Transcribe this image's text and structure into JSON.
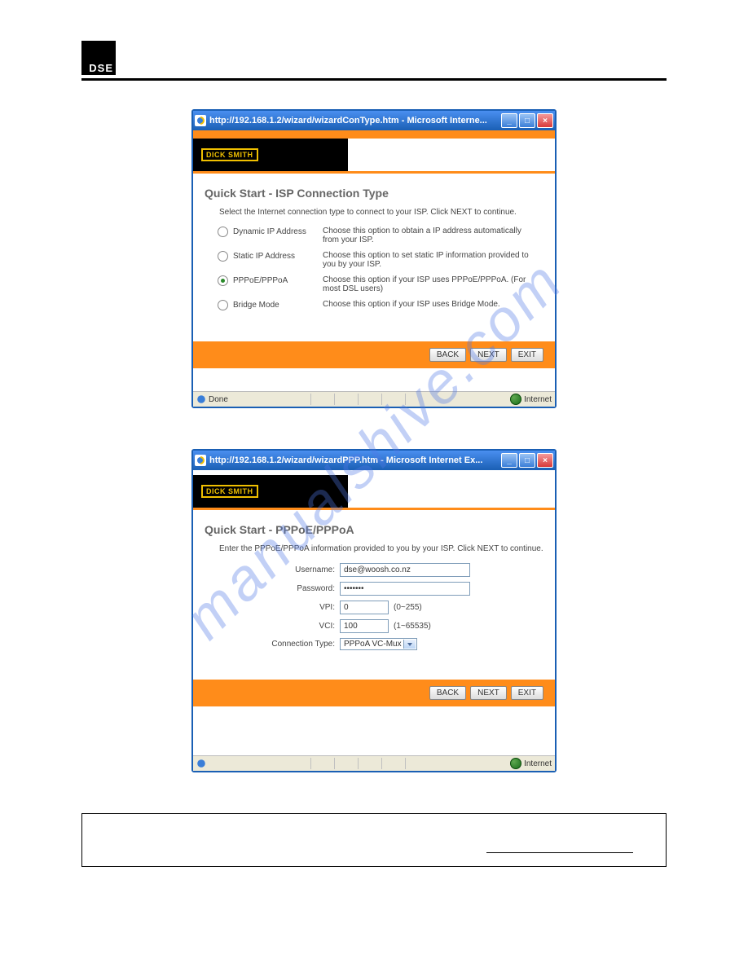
{
  "logo": "DSE",
  "watermark": "manualshive.com",
  "window1": {
    "title": "http://192.168.1.2/wizard/wizardConType.htm - Microsoft Interne...",
    "brandLabel": "DICK SMITH",
    "panelTitle": "Quick Start - ISP Connection Type",
    "panelSub": "Select the Internet connection type to connect to your ISP. Click NEXT to continue.",
    "options": [
      {
        "label": "Dynamic IP Address",
        "desc": "Choose this option to obtain a IP address automatically from your ISP.",
        "checked": false
      },
      {
        "label": "Static IP Address",
        "desc": "Choose this option to set static IP information provided to you by your ISP.",
        "checked": false
      },
      {
        "label": "PPPoE/PPPoA",
        "desc": "Choose this option if your ISP uses PPPoE/PPPoA. (For most DSL users)",
        "checked": true
      },
      {
        "label": "Bridge Mode",
        "desc": "Choose this option if your ISP uses Bridge Mode.",
        "checked": false
      }
    ],
    "buttons": {
      "back": "BACK",
      "next": "NEXT",
      "exit": "EXIT"
    },
    "status": {
      "left": "Done",
      "right": "Internet"
    }
  },
  "window2": {
    "title": "http://192.168.1.2/wizard/wizardPPP.htm - Microsoft Internet Ex...",
    "brandLabel": "DICK SMITH",
    "panelTitle": "Quick Start - PPPoE/PPPoA",
    "panelSub": "Enter the PPPoE/PPPoA information provided to you by your ISP. Click NEXT to continue.",
    "fields": {
      "usernameLabel": "Username:",
      "usernameValue": "dse@woosh.co.nz",
      "passwordLabel": "Password:",
      "passwordValue": "•••••••",
      "vpiLabel": "VPI:",
      "vpiValue": "0",
      "vpiHint": "(0~255)",
      "vciLabel": "VCI:",
      "vciValue": "100",
      "vciHint": "(1~65535)",
      "connTypeLabel": "Connection Type:",
      "connTypeValue": "PPPoA VC-Mux"
    },
    "buttons": {
      "back": "BACK",
      "next": "NEXT",
      "exit": "EXIT"
    },
    "status": {
      "left": "",
      "right": "Internet"
    }
  }
}
